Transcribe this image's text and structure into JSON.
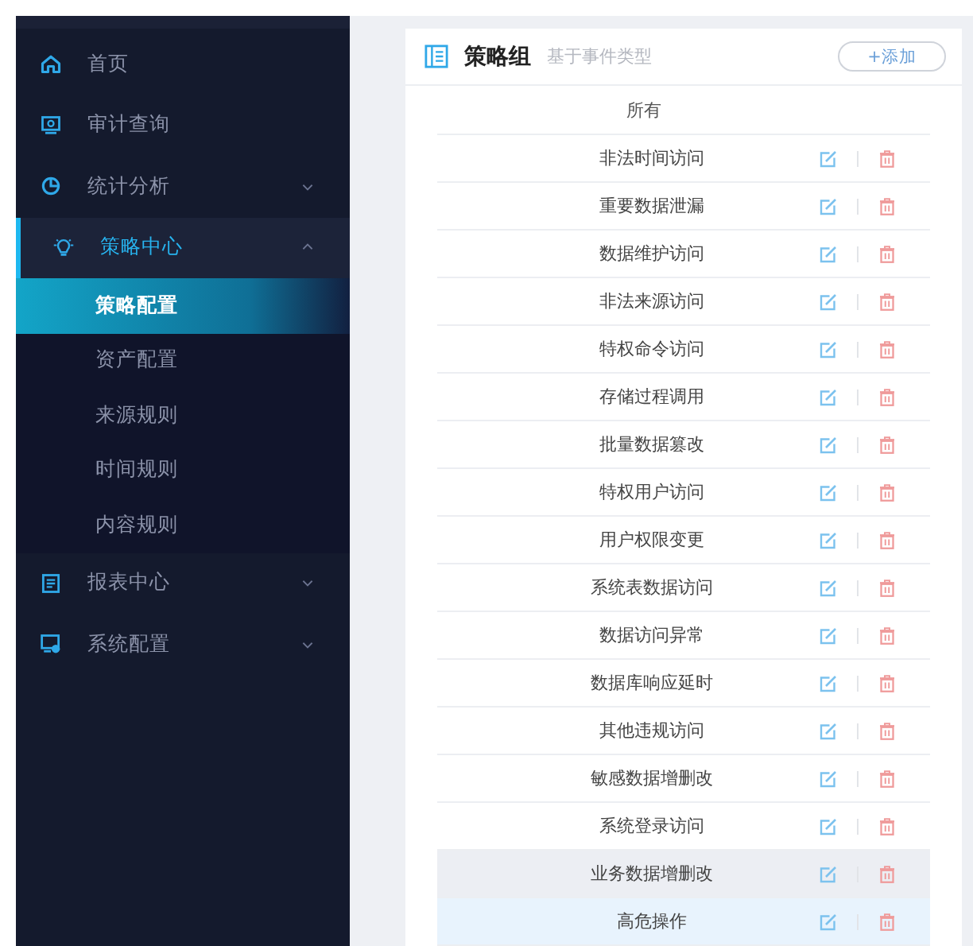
{
  "sidebar": {
    "items": [
      {
        "label": "首页",
        "selected": false
      },
      {
        "label": "审计查询",
        "selected": false
      },
      {
        "label": "统计分析",
        "selected": false,
        "expanded": false
      },
      {
        "label": "策略中心",
        "selected": true,
        "expanded": true,
        "children": [
          {
            "label": "策略配置",
            "selected": true
          },
          {
            "label": "资产配置",
            "selected": false
          },
          {
            "label": "来源规则",
            "selected": false
          },
          {
            "label": "时间规则",
            "selected": false
          },
          {
            "label": "内容规则",
            "selected": false
          }
        ]
      },
      {
        "label": "报表中心",
        "selected": false,
        "expanded": false
      },
      {
        "label": "系统配置",
        "selected": false,
        "expanded": false
      }
    ]
  },
  "panel": {
    "title": "策略组",
    "subtitle": "基于事件类型",
    "add_button": "+添加",
    "all_label": "所有",
    "rows": [
      {
        "name": "非法时间访问",
        "hovered": false,
        "selected": false
      },
      {
        "name": "重要数据泄漏",
        "hovered": false,
        "selected": false
      },
      {
        "name": "数据维护访问",
        "hovered": false,
        "selected": false
      },
      {
        "name": "非法来源访问",
        "hovered": false,
        "selected": false
      },
      {
        "name": "特权命令访问",
        "hovered": false,
        "selected": false
      },
      {
        "name": "存储过程调用",
        "hovered": false,
        "selected": false
      },
      {
        "name": "批量数据篡改",
        "hovered": false,
        "selected": false
      },
      {
        "name": "特权用户访问",
        "hovered": false,
        "selected": false
      },
      {
        "name": "用户权限变更",
        "hovered": false,
        "selected": false
      },
      {
        "name": "系统表数据访问",
        "hovered": false,
        "selected": false
      },
      {
        "name": "数据访问异常",
        "hovered": false,
        "selected": false
      },
      {
        "name": "数据库响应延时",
        "hovered": false,
        "selected": false
      },
      {
        "name": "其他违规访问",
        "hovered": false,
        "selected": false
      },
      {
        "name": "敏感数据增删改",
        "hovered": false,
        "selected": false
      },
      {
        "name": "系统登录访问",
        "hovered": false,
        "selected": false
      },
      {
        "name": "业务数据增删改",
        "hovered": true,
        "selected": false
      },
      {
        "name": "高危操作",
        "hovered": false,
        "selected": true
      }
    ]
  }
}
